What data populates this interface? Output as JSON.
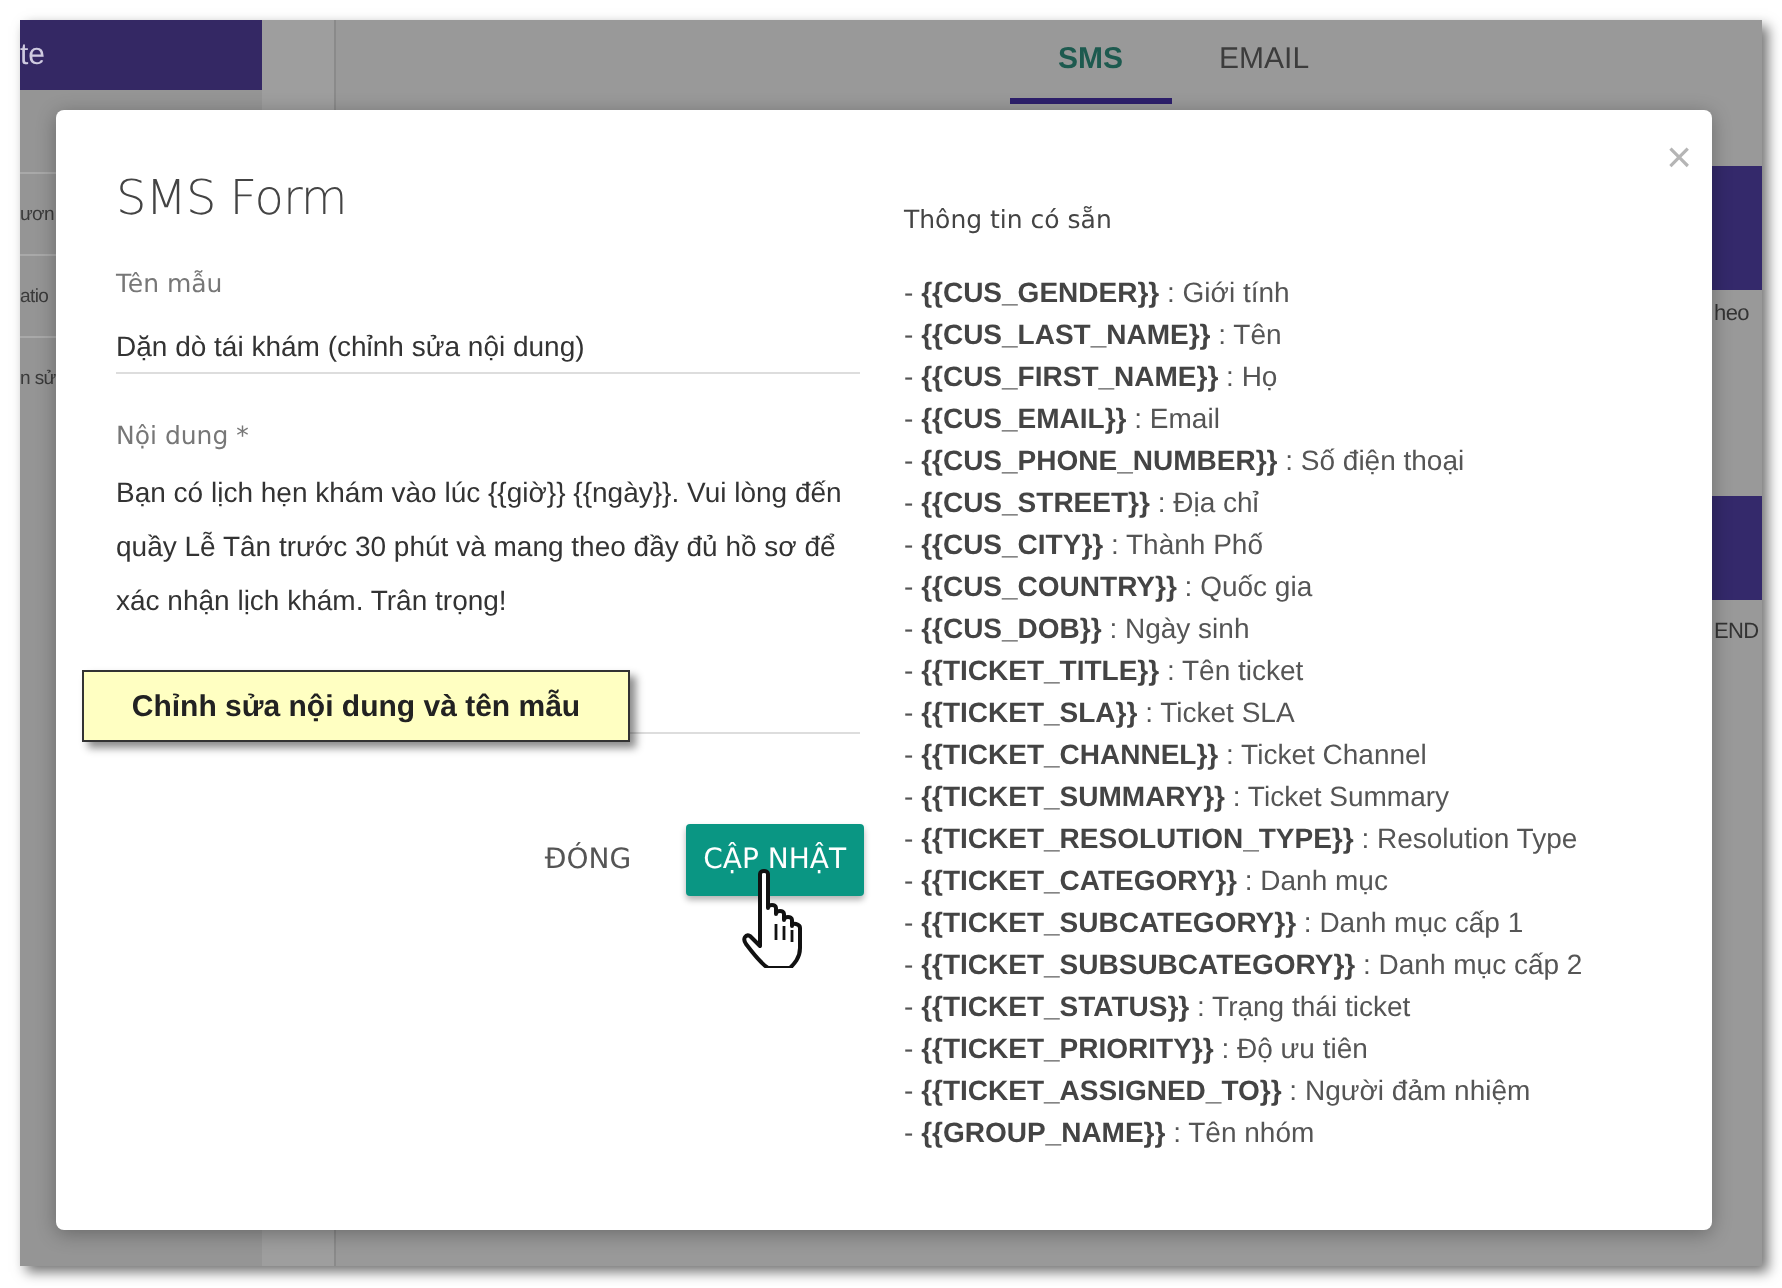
{
  "background": {
    "sidebar_header": "te",
    "sidebar_items": [
      "ươn",
      "atio",
      "n sử"
    ],
    "tabs": [
      {
        "label": "SMS",
        "selected": true
      },
      {
        "label": "EMAIL",
        "selected": false
      }
    ],
    "right_texts": [
      "heo",
      "END"
    ]
  },
  "dialog": {
    "title": "SMS Form",
    "close": "×",
    "fields": [
      {
        "kind": "input",
        "label": "Tên mẫu",
        "value": "Dặn dò tái khám (chỉnh sửa nội dung)"
      },
      {
        "kind": "textarea",
        "label": "Nội dung *",
        "value": "Bạn có lịch hẹn khám vào lúc {{giờ}} {{ngày}}. Vui lòng đến quầy Lễ Tân trước 30 phút và mang theo đầy đủ hồ sơ để xác nhận lịch khám. Trân trọng!"
      }
    ],
    "buttons": [
      {
        "kind": "flat",
        "label": "ĐÓNG"
      },
      {
        "kind": "primary",
        "label": "CẬP NHẬT"
      }
    ],
    "variables": {
      "heading": "Thông tin có sẵn",
      "items": [
        "- **{{CUS_GENDER}}** : Giới tính",
        "- **{{CUS_LAST_NAME}}** : Tên",
        "- **{{CUS_FIRST_NAME}}** : Họ",
        "- **{{CUS_EMAIL}}** : Email",
        "- **{{CUS_PHONE_NUMBER}}** : Số điện thoại",
        "- **{{CUS_STREET}}** : Địa chỉ",
        "- **{{CUS_CITY}}** : Thành Phố",
        "- **{{CUS_COUNTRY}}** : Quốc gia",
        "- **{{CUS_DOB}}** : Ngày sinh",
        "- **{{TICKET_TITLE}}** : Tên ticket",
        "- **{{TICKET_SLA}}** : Ticket SLA",
        "- **{{TICKET_CHANNEL}}** : Ticket Channel",
        "- **{{TICKET_SUMMARY}}** : Ticket Summary",
        "- **{{TICKET_RESOLUTION_TYPE}}** : Resolution Type",
        "- **{{TICKET_CATEGORY}}** : Danh mục",
        "- **{{TICKET_SUBCATEGORY}}** : Danh mục cấp 1",
        "- **{{TICKET_SUBSUBCATEGORY}}** : Danh mục cấp 2",
        "- **{{TICKET_STATUS}}** : Trạng thái ticket",
        "- **{{TICKET_PRIORITY}}** : Độ ưu tiên",
        "- **{{TICKET_ASSIGNED_TO}}** : Người đảm nhiệm",
        "- **{{GROUP_NAME}}** : Tên nhóm"
      ]
    }
  },
  "callout": "Chỉnh sửa nội dung và tên mẫu"
}
